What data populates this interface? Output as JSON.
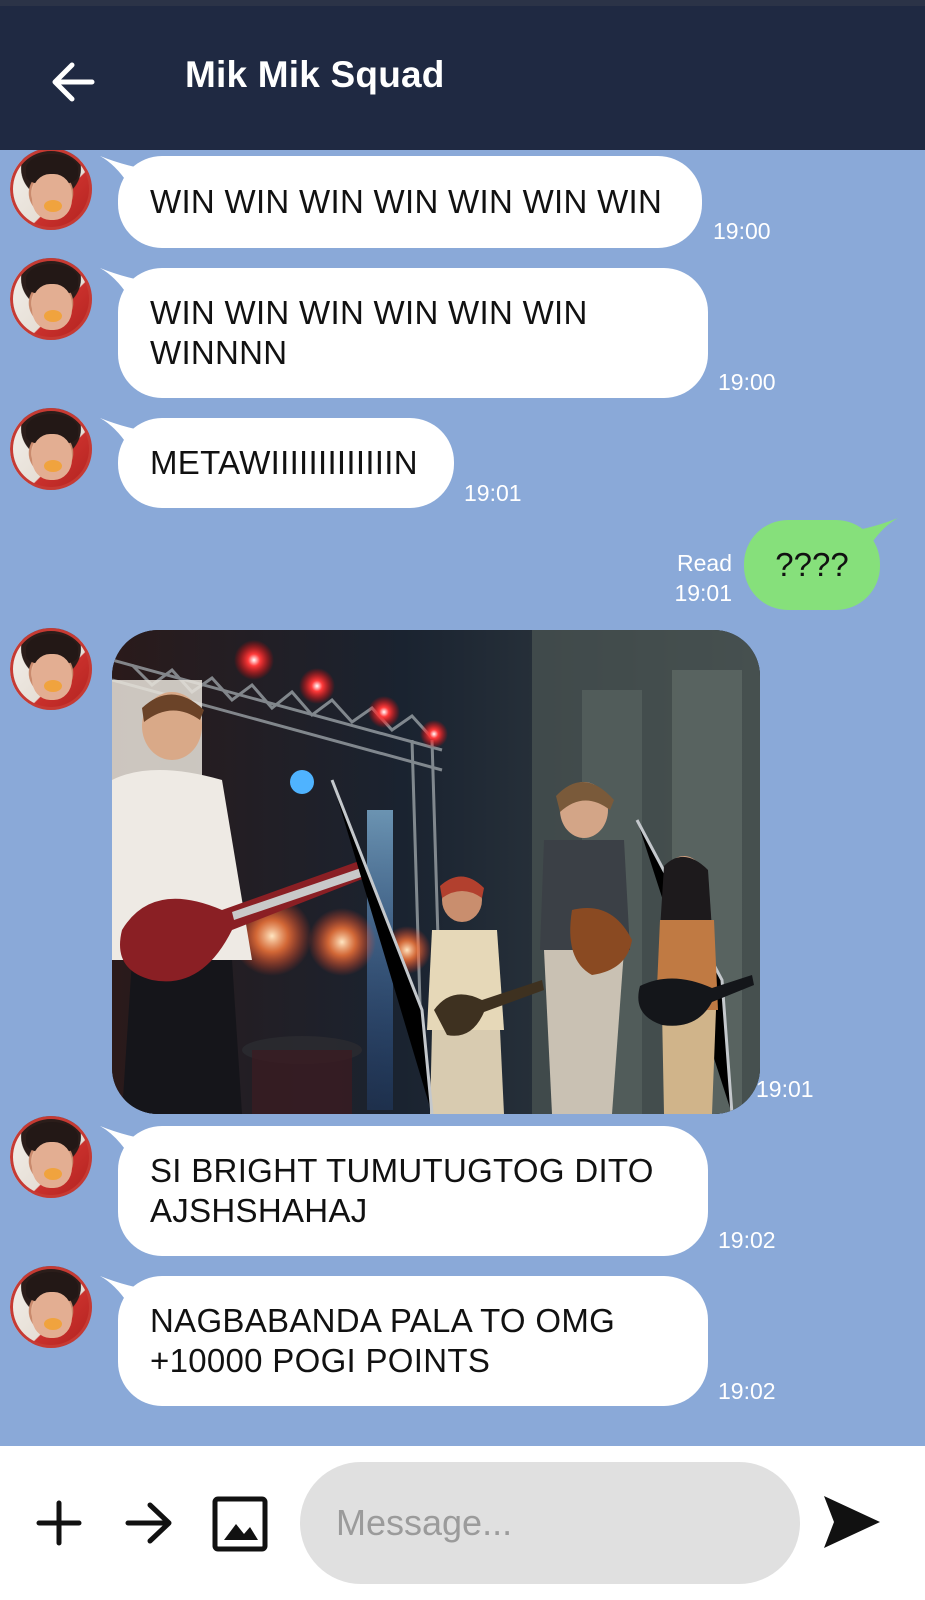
{
  "header": {
    "title": "Mik Mik Squad"
  },
  "messages": [
    {
      "text": "WIN WIN WIN WIN WIN WIN WIN",
      "time": "19:00"
    },
    {
      "text": "WIN WIN WIN WIN WIN WIN\nWINNNN",
      "time": "19:00"
    },
    {
      "text": "METAWIIIIIIIIIIIIIN",
      "time": "19:01"
    },
    {
      "text": "????",
      "time": "19:01",
      "status": "Read"
    },
    {
      "time": "19:01"
    },
    {
      "text": "SI BRIGHT TUMUTUGTOG DITO\nAJSHSHAHAJ",
      "time": "19:02"
    },
    {
      "text": "NAGBABANDA PALA TO OMG\n+10000 POGI POINTS",
      "time": "19:02"
    }
  ],
  "input": {
    "placeholder": "Message..."
  },
  "colors": {
    "header": "#1f2942",
    "chat_background": "#8aa9d8",
    "incoming_bubble": "#ffffff",
    "outgoing_bubble": "#86e07b"
  },
  "icons": {
    "back": "arrow-left-icon",
    "add": "plus-icon",
    "forward": "arrow-right-icon",
    "gallery": "image-icon",
    "send": "send-icon"
  }
}
